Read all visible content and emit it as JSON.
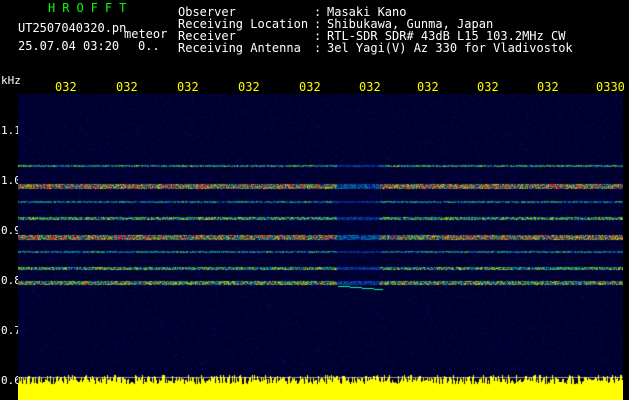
{
  "header": {
    "logo": "HROFFT",
    "filename": "UT2507040320.pn",
    "filename_suffix": "meteor",
    "datetime": "25.07.04 03:20",
    "count": "0..",
    "info_rows": [
      {
        "label": "Observer",
        "sep": ":",
        "value": "Masaki Kano"
      },
      {
        "label": "Receiving Location",
        "sep": ":",
        "value": "Shibukawa, Gunma, Japan"
      },
      {
        "label": "Receiver",
        "sep": ":",
        "value": "RTL-SDR SDR# 43dB L15 103.2MHz CW"
      },
      {
        "label": "Receiving Antenna",
        "sep": ":",
        "value": "3el Yagi(V) Az 330 for Vladivostok"
      }
    ]
  },
  "y_axis": {
    "unit": "kHz",
    "ticks": [
      "1.1",
      "1.0",
      "0.9",
      "0.8",
      "0.7",
      "0.6"
    ]
  },
  "time_axis": {
    "labels": [
      "032",
      "032",
      "032",
      "032",
      "032",
      "032",
      "032",
      "032",
      "032",
      "0330"
    ]
  },
  "colors": {
    "background": "#000000",
    "plot_background": "#000033",
    "logo": "#00ff00",
    "text": "#ffffff",
    "time_labels": "#ffff00",
    "signal_bar": "#ffff00"
  }
}
